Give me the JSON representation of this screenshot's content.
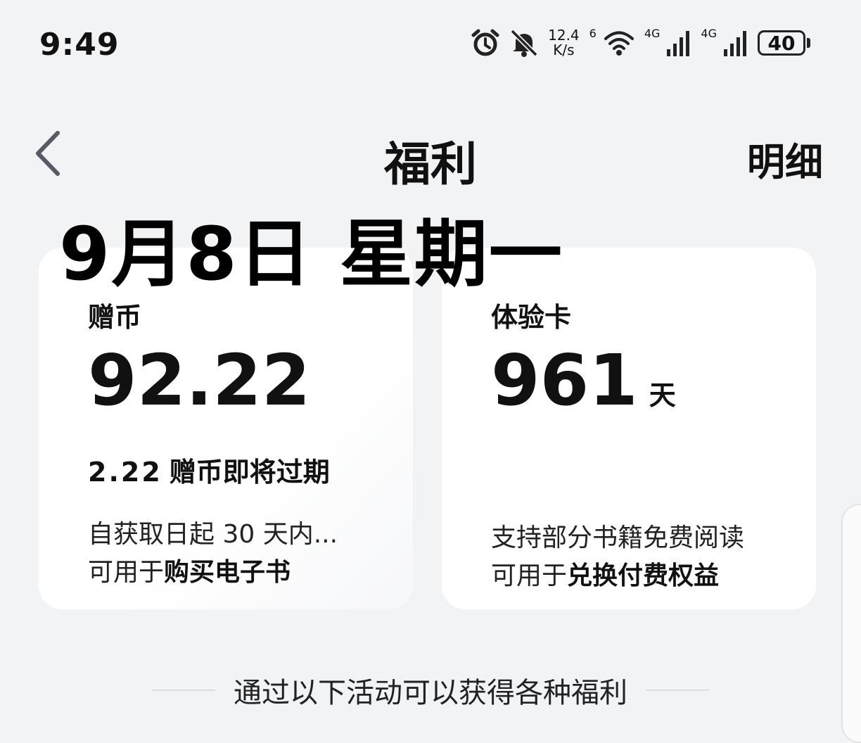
{
  "status_bar": {
    "time": "9:49",
    "net_speed_value": "12.4",
    "net_speed_unit": "K/s",
    "wifi_label": "6",
    "signal1_label": "4G",
    "signal2_label": "4G",
    "battery": "40"
  },
  "header": {
    "title": "福利",
    "detail_label": "明细"
  },
  "date_overlay": "9月8日 星期一",
  "coins_card": {
    "label": "赠币",
    "value": "92.22",
    "expire_amount": "2.22",
    "expire_text": "赠币即将过期",
    "desc_line1": "自获取日起 30 天内...",
    "desc_line2_prefix": "可用于",
    "desc_line2_bold": "购买电子书"
  },
  "trial_card": {
    "label": "体验卡",
    "value": "961",
    "unit": "天",
    "desc_line1": "支持部分书籍免费阅读",
    "desc_line2_prefix": "可用于",
    "desc_line2_bold": "兑换付费权益"
  },
  "section_caption": "通过以下活动可以获得各种福利"
}
